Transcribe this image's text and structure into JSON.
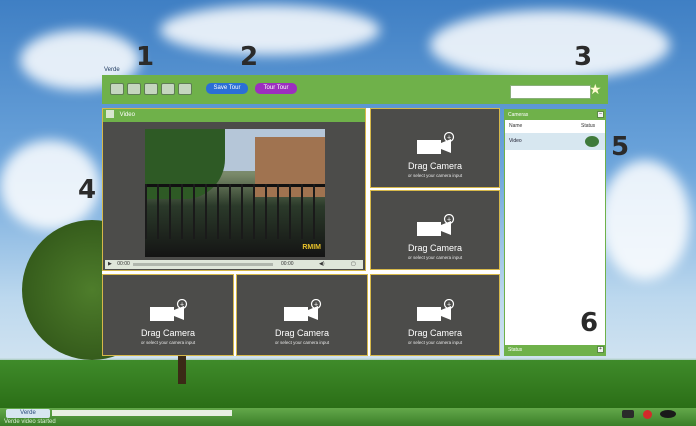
{
  "window": {
    "title": "Verde"
  },
  "toolbar": {
    "tool_icons": [
      "layout-1x1-icon",
      "layout-2x2-icon",
      "layout-3x3-icon",
      "layout-4x4-icon",
      "layout-custom-icon"
    ],
    "buttons": [
      {
        "label": "Save Tour",
        "color": "#2b6fd6"
      },
      {
        "label": "Tour Tour",
        "color": "#9c2fbf"
      }
    ],
    "search": {
      "value": "",
      "placeholder": ""
    }
  },
  "player": {
    "title": "Video",
    "time_start": "00:00",
    "time_end": "00:00",
    "watermark": "RMIM"
  },
  "cells": [
    {
      "title": "Drag Camera",
      "subtitle": "or select your camera input"
    },
    {
      "title": "Drag Camera",
      "subtitle": "or select your camera input"
    },
    {
      "title": "Drag Camera",
      "subtitle": "or select your camera input"
    },
    {
      "title": "Drag Camera",
      "subtitle": "or select your camera input"
    },
    {
      "title": "Drag Camera",
      "subtitle": "or select your camera input"
    }
  ],
  "side_panel": {
    "title": "Cameras",
    "columns": [
      "Name",
      "Status"
    ],
    "rows": [
      {
        "name": "Video",
        "status_color": "#3f7a3a"
      }
    ],
    "footer": "Status"
  },
  "callouts": [
    "1",
    "2",
    "3",
    "4",
    "5",
    "6"
  ],
  "taskbar": {
    "start_label": "Verde",
    "status_text": "Verde video started"
  }
}
